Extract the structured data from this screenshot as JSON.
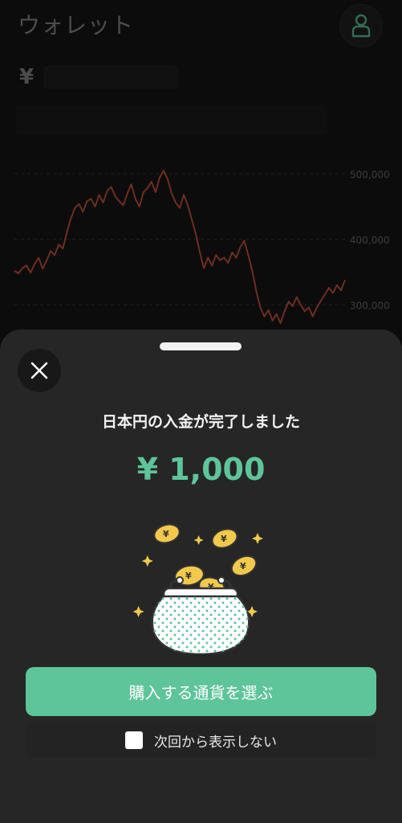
{
  "header": {
    "title": "ウォレット",
    "profile_icon": "user-icon"
  },
  "balance": {
    "currency_symbol": "¥"
  },
  "chart_data": {
    "type": "line",
    "ticks": [
      "500,000",
      "400,000",
      "300,000"
    ],
    "ylim": [
      250000,
      520000
    ],
    "grid": true,
    "color": "#c8553a",
    "values": [
      352000,
      348000,
      356000,
      360000,
      349000,
      362000,
      372000,
      355000,
      368000,
      382000,
      376000,
      392000,
      386000,
      410000,
      432000,
      448000,
      454000,
      442000,
      458000,
      462000,
      450000,
      468000,
      456000,
      474000,
      480000,
      466000,
      458000,
      452000,
      470000,
      484000,
      462000,
      450000,
      472000,
      478000,
      488000,
      472000,
      494000,
      505000,
      492000,
      470000,
      456000,
      448000,
      468000,
      452000,
      430000,
      408000,
      380000,
      356000,
      372000,
      360000,
      376000,
      368000,
      372000,
      364000,
      380000,
      372000,
      388000,
      398000,
      376000,
      352000,
      320000,
      296000,
      282000,
      292000,
      276000,
      286000,
      272000,
      290000,
      305000,
      298000,
      312000,
      300000,
      290000,
      296000,
      282000,
      296000,
      306000,
      316000,
      326000,
      318000,
      330000,
      322000,
      338000
    ],
    "accent_green": "#5ec49a"
  },
  "sheet": {
    "close_icon": "close-icon",
    "title": "日本円の入金が完了しました",
    "amount": "¥ 1,000",
    "illustration": "coin-purse-illustration",
    "primary_button": "購入する通貨を選ぶ",
    "checkbox_label": "次回から表示しない"
  }
}
